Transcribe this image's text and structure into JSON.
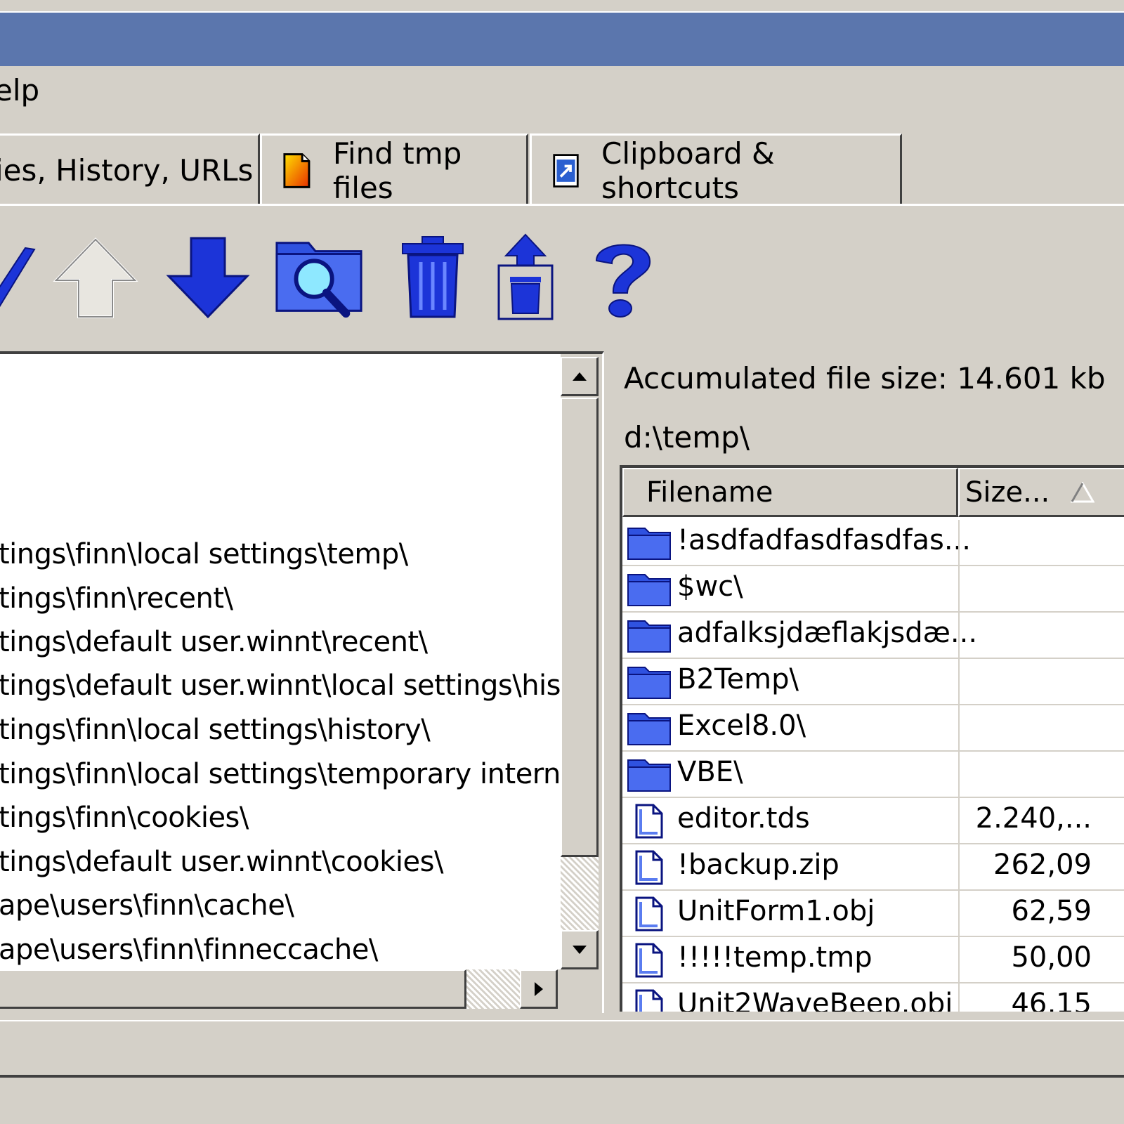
{
  "menu": {
    "help_label": "elp"
  },
  "tabs": [
    {
      "label": "ies, History, URLs"
    },
    {
      "label": "Find tmp files"
    },
    {
      "label": "Clipboard & shortcuts"
    }
  ],
  "toolbar": {
    "buttons": [
      "check-icon",
      "up-arrow-icon",
      "down-arrow-icon",
      "search-folder-icon",
      "trash-icon",
      "empty-trash-icon",
      "help-icon"
    ]
  },
  "left_paths": [
    "tings\\finn\\local settings\\temp\\",
    "tings\\finn\\recent\\",
    "tings\\default user.winnt\\recent\\",
    "tings\\default user.winnt\\local settings\\histor",
    "tings\\finn\\local settings\\history\\",
    "tings\\finn\\local settings\\temporary internet f",
    "tings\\finn\\cookies\\",
    "tings\\default user.winnt\\cookies\\",
    "ape\\users\\finn\\cache\\",
    "ape\\users\\finn\\finneccache\\"
  ],
  "info": {
    "accumulated": "Accumulated file size: 14.601 kb",
    "path": "d:\\temp\\"
  },
  "list": {
    "headers": {
      "filename": "Filename",
      "size": "Size..."
    },
    "rows": [
      {
        "name": "!asdfadfasdfasdfas...",
        "size": "",
        "kind": "folder"
      },
      {
        "name": "$wc\\",
        "size": "",
        "kind": "folder"
      },
      {
        "name": "adfalksjdæflakjsdæ...",
        "size": "",
        "kind": "folder"
      },
      {
        "name": "B2Temp\\",
        "size": "",
        "kind": "folder"
      },
      {
        "name": "Excel8.0\\",
        "size": "",
        "kind": "folder"
      },
      {
        "name": "VBE\\",
        "size": "",
        "kind": "folder"
      },
      {
        "name": "editor.tds",
        "size": "2.240,...",
        "kind": "file"
      },
      {
        "name": "!backup.zip",
        "size": "262,09",
        "kind": "file"
      },
      {
        "name": "UnitForm1.obj",
        "size": "62,59",
        "kind": "file"
      },
      {
        "name": "!!!!!temp.tmp",
        "size": "50,00",
        "kind": "file"
      },
      {
        "name": "Unit2WaveBeep.obj",
        "size": "46,15",
        "kind": "file"
      }
    ]
  },
  "colors": {
    "title_bar": "#5b76ad",
    "face": "#d4d0c8",
    "icon_blue": "#1c34d8"
  }
}
